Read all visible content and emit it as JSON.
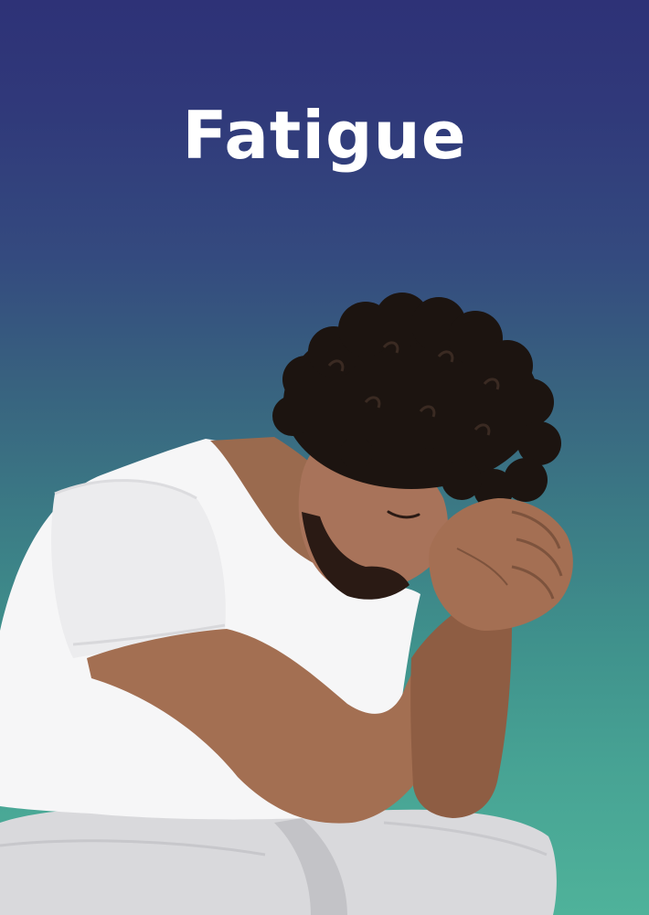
{
  "card": {
    "title": "Fatigue",
    "title_color": "#ffffff",
    "gradient_top": "#2e3277",
    "gradient_bottom": "#4fb29a",
    "photo": "man-seated-head-in-hands"
  }
}
